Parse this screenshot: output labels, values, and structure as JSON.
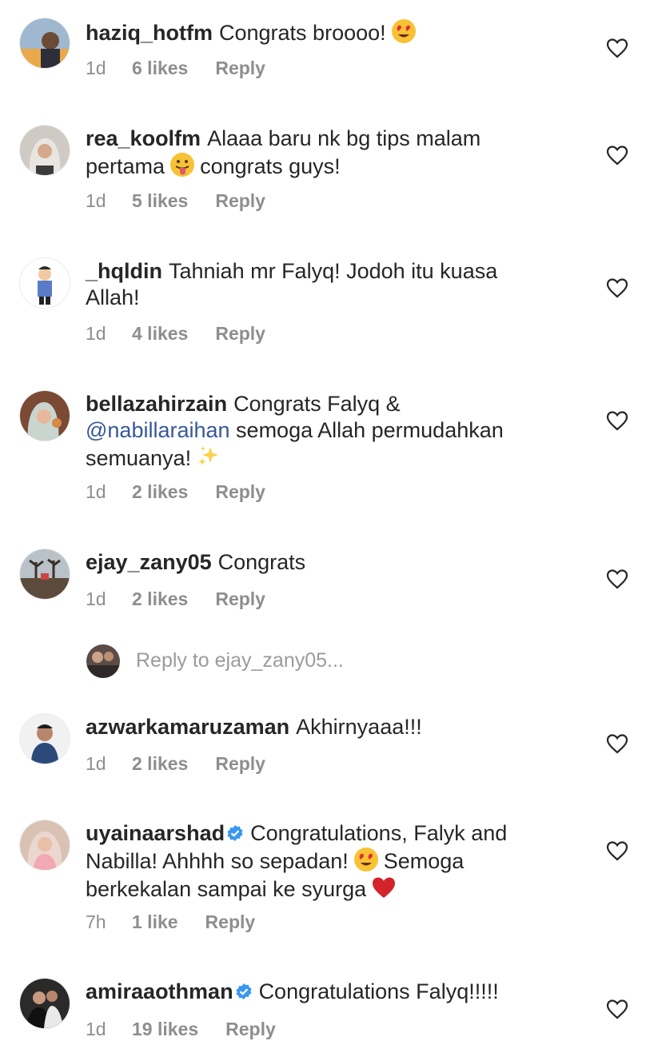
{
  "comments": [
    {
      "username": "haziq_hotfm",
      "text": "Congrats broooo!",
      "emoji": "heart-eyes",
      "time": "1d",
      "likes": "6 likes",
      "reply": "Reply"
    },
    {
      "username": "rea_koolfm",
      "text_before": "Alaaa baru nk bg tips malam pertama",
      "emoji": "tongue-out",
      "text_after": "congrats guys!",
      "time": "1d",
      "likes": "5 likes",
      "reply": "Reply"
    },
    {
      "username": "_hqldin",
      "text": "Tahniah mr Falyq! Jodoh itu kuasa Allah!",
      "time": "1d",
      "likes": "4 likes",
      "reply": "Reply"
    },
    {
      "username": "bellazahirzain",
      "text_before": "Congrats Falyq &",
      "mention": "@nabillaraihan",
      "text_after": "semoga Allah permudahkan semuanya!",
      "emoji": "sparkles",
      "time": "1d",
      "likes": "2 likes",
      "reply": "Reply"
    },
    {
      "username": "ejay_zany05",
      "text": "Congrats",
      "time": "1d",
      "likes": "2 likes",
      "reply": "Reply"
    },
    {
      "username": "azwarkamaruzaman",
      "text": "Akhirnyaaa!!!",
      "time": "1d",
      "likes": "2 likes",
      "reply": "Reply"
    },
    {
      "username": "uyainaarshad",
      "verified": true,
      "text_before": "Congratulations, Falyk and Nabilla! Ahhhh so sepadan!",
      "emoji": "heart-eyes",
      "text_after": "Semoga berkekalan sampai ke syurga",
      "emoji2": "red-heart",
      "time": "7h",
      "likes": "1 like",
      "reply": "Reply"
    },
    {
      "username": "amiraaothman",
      "verified": true,
      "text": "Congratulations Falyq!!!!!",
      "time": "1d",
      "likes": "19 likes",
      "reply": "Reply"
    }
  ],
  "reply_input": {
    "placeholder": "Reply to ejay_zany05..."
  },
  "icons": {
    "like": "heart-outline-icon",
    "verified": "verified-badge-icon"
  },
  "colors": {
    "text": "#262626",
    "meta": "#8e8e8e",
    "mention": "#385898",
    "verified": "#3897f0",
    "heart_emoji": "#d3242b"
  }
}
